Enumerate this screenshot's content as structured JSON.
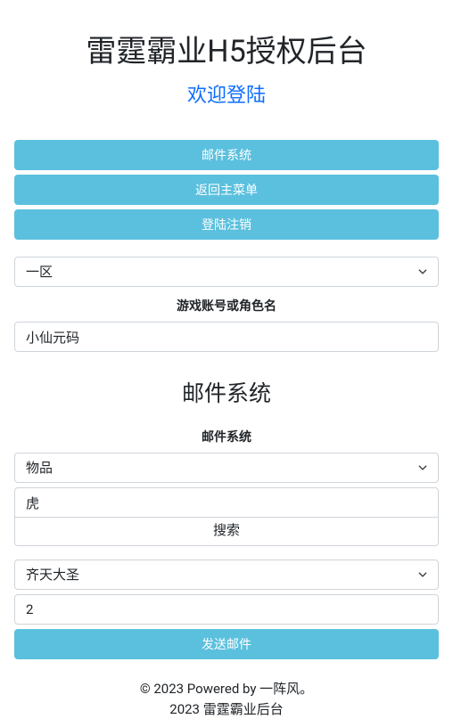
{
  "header": {
    "title": "雷霆霸业H5授权后台",
    "subtitle": "欢迎登陆"
  },
  "nav": {
    "mail_system": "邮件系统",
    "back_main_menu": "返回主菜单",
    "logout": "登陆注销"
  },
  "zone_select": {
    "selected": "一区"
  },
  "account": {
    "label": "游戏账号或角色名",
    "value": "小仙元码"
  },
  "mail_section": {
    "title": "邮件系统",
    "label": "邮件系统",
    "type_selected": "物品",
    "search_value": "虎",
    "search_button": "搜索",
    "item_selected": "齐天大圣",
    "quantity": "2",
    "send_button": "发送邮件"
  },
  "footer": {
    "line1": "© 2023 Powered by 一阵风。",
    "line2": "2023 雷霆霸业后台"
  }
}
